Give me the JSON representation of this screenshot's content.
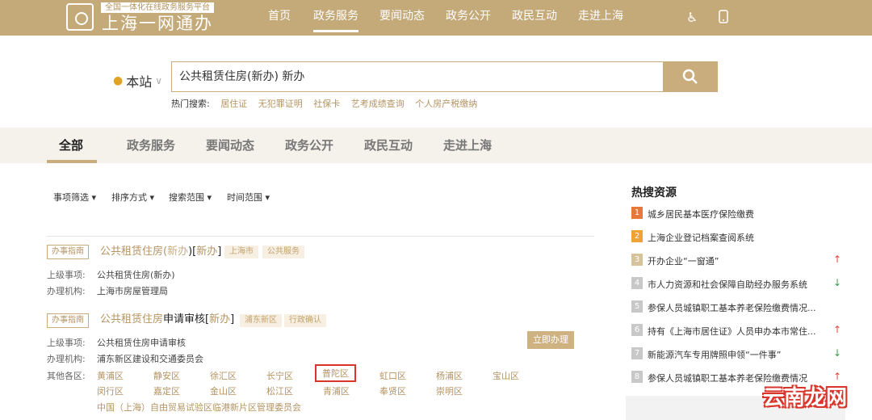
{
  "header": {
    "logo_sub": "全国一体化在线政务服务平台",
    "logo_main": "上海一网通办",
    "nav": [
      "首页",
      "政务服务",
      "要闻动态",
      "政务公开",
      "政民互动",
      "走进上海"
    ],
    "icons": [
      "accessibility-icon",
      "mobile-icon"
    ]
  },
  "search": {
    "location": "本站",
    "query": "公共租赁住房(新办) 新办",
    "hot_label": "热门搜索:",
    "hot": [
      "居住证",
      "无犯罪证明",
      "社保卡",
      "艺考成绩查询",
      "个人房产税缴纳"
    ]
  },
  "tabs": [
    "全部",
    "政务服务",
    "要闻动态",
    "政务公开",
    "政民互动",
    "走进上海"
  ],
  "filters": [
    "事项筛选",
    "排序方式",
    "搜索范围",
    "时间范围"
  ],
  "results": [
    {
      "badge": "办事指南",
      "title_a": "公共租赁住房(",
      "title_hl1": "新办",
      "title_b": ")[",
      "title_hl2": "新办",
      "title_c": "]",
      "tags": [
        "上海市",
        "公共服务"
      ],
      "parent_label": "上级事项:",
      "parent": "公共租赁住房(新办)",
      "org_label": "办理机构:",
      "org": "上海市房屋管理局"
    },
    {
      "badge": "办事指南",
      "title_a": "公共租赁住房",
      "title_dark": "申请审核",
      "title_b": "[",
      "title_hl": "新办",
      "title_c": "]",
      "tags": [
        "浦东新区",
        "行政确认"
      ],
      "parent_label": "上级事项:",
      "parent": "公共租赁住房申请审核",
      "org_label": "办理机构:",
      "org": "浦东新区建设和交通委员会",
      "apply": "立即办理",
      "districts_label": "其他各区:",
      "districts_row1": [
        "黄浦区",
        "静安区",
        "徐汇区",
        "长宁区",
        "普陀区",
        "虹口区",
        "杨浦区",
        "宝山区"
      ],
      "districts_row2": [
        "闵行区",
        "嘉定区",
        "金山区",
        "松江区",
        "青浦区",
        "奉贤区",
        "崇明区"
      ],
      "districts_row3": [
        "中国（上海）自由贸易试验区临港新片区管理委员会"
      ]
    }
  ],
  "sidebar": {
    "title": "热搜资源",
    "items": [
      {
        "rank": "1",
        "text": "城乡居民基本医疗保险缴费",
        "trend": "",
        "color": "#e8773a"
      },
      {
        "rank": "2",
        "text": "上海企业登记档案查阅系统",
        "trend": "",
        "color": "#f0a236"
      },
      {
        "rank": "3",
        "text": "开办企业“一窗通”",
        "trend": "up",
        "color": "#d6c39a"
      },
      {
        "rank": "4",
        "text": "市人力资源和社会保障自助经办服务系统",
        "trend": "down",
        "color": "#c8c8c8"
      },
      {
        "rank": "5",
        "text": "参保人员城镇职工基本养老保险缴费情况...",
        "trend": "",
        "color": "#c8c8c8"
      },
      {
        "rank": "6",
        "text": "持有《上海市居住证》人员申办本市常住...",
        "trend": "up",
        "color": "#c8c8c8"
      },
      {
        "rank": "7",
        "text": "新能源汽车专用牌照申领“一件事”",
        "trend": "down",
        "color": "#c8c8c8"
      },
      {
        "rank": "8",
        "text": "参保人员城镇职工基本养老保险缴费情况",
        "trend": "up",
        "color": "#c8c8c8"
      }
    ]
  },
  "watermark": "云南龙网",
  "colors": {
    "brand": "#c4a979",
    "accent": "#b59463",
    "highlight_border": "#d9352b"
  }
}
